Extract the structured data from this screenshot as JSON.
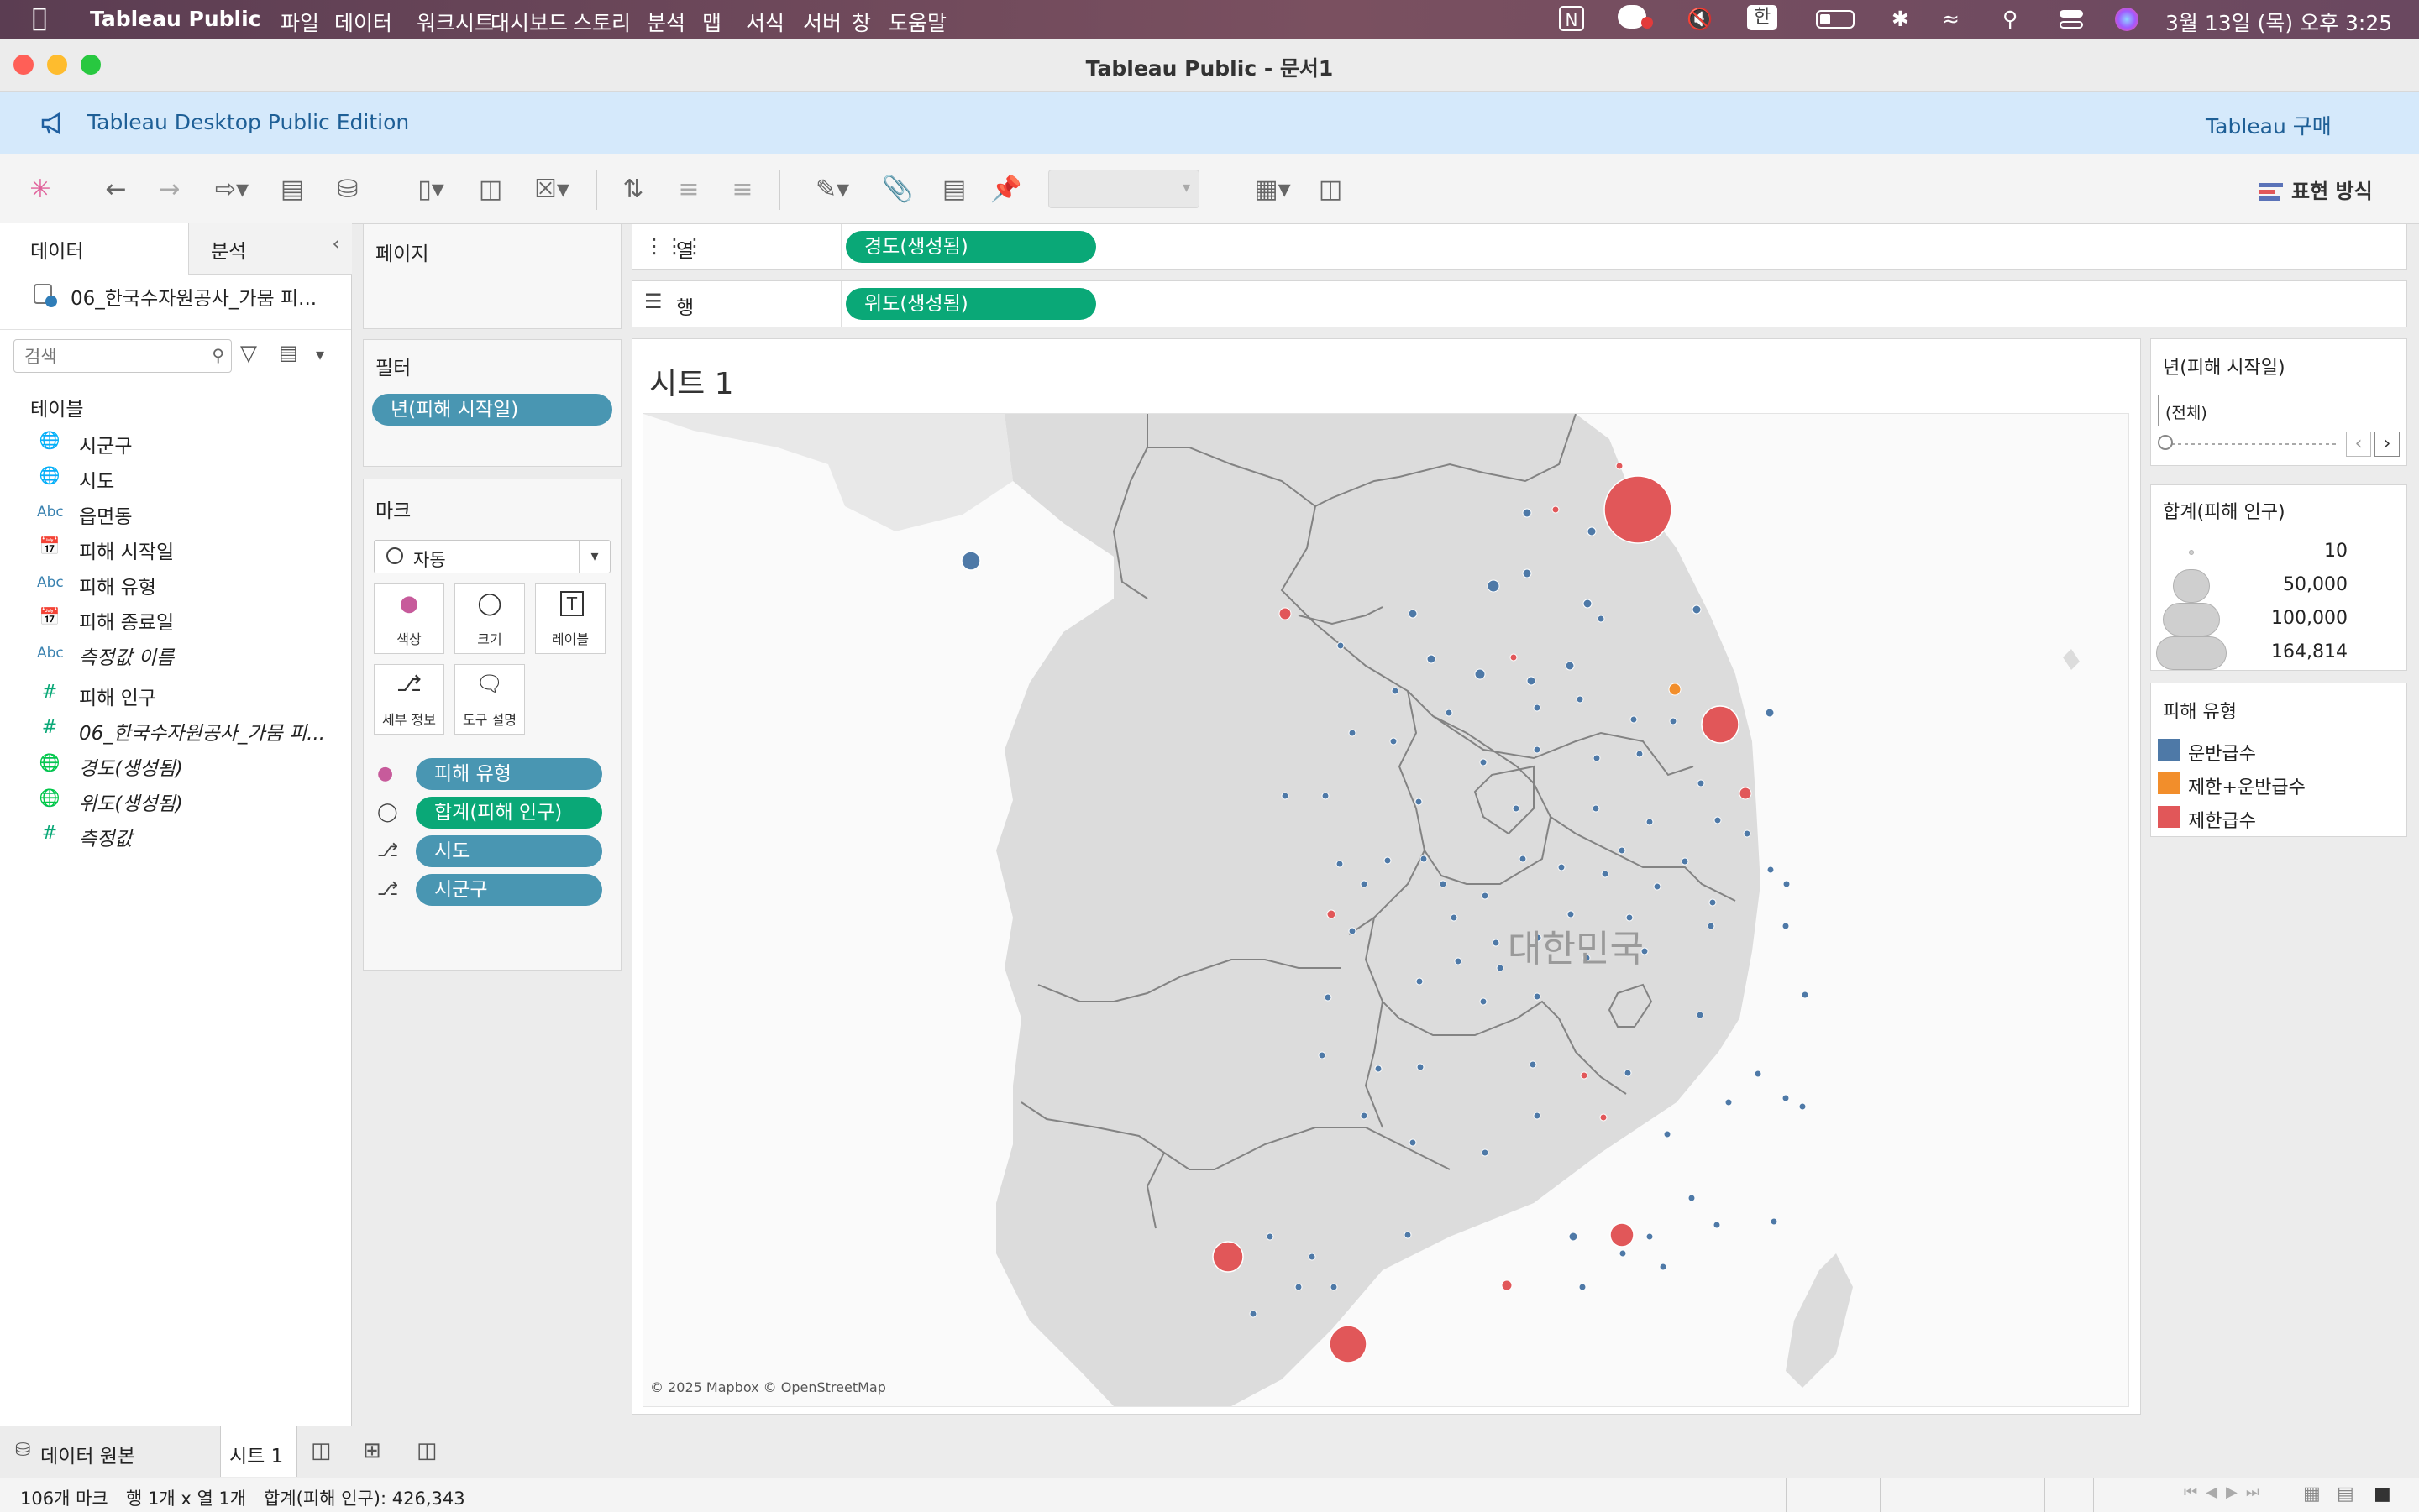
{
  "menubar": {
    "app_name": "Tableau Public",
    "items": [
      "파일",
      "데이터",
      "워크시트",
      "대시보드",
      "스토리",
      "분석",
      "맵",
      "서식",
      "서버",
      "창",
      "도움말"
    ],
    "ime": "한",
    "clock": "3월 13일 (목) 오후 3:25"
  },
  "window": {
    "title": "Tableau Public - 문서1"
  },
  "banner": {
    "text": "Tableau Desktop Public Edition",
    "buy_link": "Tableau 구매"
  },
  "toolbar": {
    "show_me": "표현 방식"
  },
  "data_pane": {
    "tab_data": "데이터",
    "tab_analysis": "분석",
    "datasource": "06_한국수자원공사_가뭄 피...",
    "search_placeholder": "검색",
    "tables_header": "테이블",
    "fields": [
      {
        "icon": "globe-icon",
        "label": "시군구"
      },
      {
        "icon": "globe-icon",
        "label": "시도"
      },
      {
        "icon": "abc-icon",
        "label": "읍면동"
      },
      {
        "icon": "calendar-icon",
        "label": "피해 시작일"
      },
      {
        "icon": "abc-icon",
        "label": "피해 유형"
      },
      {
        "icon": "calendar-icon",
        "label": "피해 종료일"
      },
      {
        "icon": "abc-icon",
        "label": "측정값 이름"
      },
      {
        "icon": "number-icon",
        "label": "피해 인구"
      },
      {
        "icon": "number-icon",
        "label": "06_한국수자원공사_가뭄 피..."
      },
      {
        "icon": "globe-icon",
        "label": "경도(생성됨)"
      },
      {
        "icon": "globe-icon",
        "label": "위도(생성됨)"
      },
      {
        "icon": "number-icon",
        "label": "측정값"
      }
    ]
  },
  "shelves": {
    "pages_label": "페이지",
    "filters_label": "필터",
    "filter_pill": "년(피해 시작일)",
    "columns_label": "열",
    "columns_pill": "경도(생성됨)",
    "rows_label": "행",
    "rows_pill": "위도(생성됨)"
  },
  "marks": {
    "label": "마크",
    "type": "자동",
    "buttons": [
      "색상",
      "크기",
      "레이블",
      "세부 정보",
      "도구 설명"
    ],
    "pills": [
      "피해 유형",
      "합계(피해 인구)",
      "시도",
      "시군구"
    ]
  },
  "sheet": {
    "title": "시트 1",
    "map_label": "대한민국",
    "attribution": "© 2025 Mapbox © OpenStreetMap"
  },
  "legends": {
    "filter_title": "년(피해 시작일)",
    "filter_value": "(전체)",
    "size_title": "합계(피해 인구)",
    "size_values": [
      "10",
      "50,000",
      "100,000",
      "164,814"
    ],
    "color_title": "피해 유형",
    "color_items": [
      {
        "label": "운반급수",
        "color": "#4e79a7"
      },
      {
        "label": "제한+운반급수",
        "color": "#f28e2b"
      },
      {
        "label": "제한급수",
        "color": "#e15759"
      }
    ]
  },
  "bottom_tabs": {
    "datasource": "데이터 원본",
    "sheet": "시트 1"
  },
  "status": {
    "marks": "106개 마크",
    "rows_cols": "행 1개 x 열 1개",
    "sum": "합계(피해 인구): 426,343"
  },
  "colors": {
    "blue": "#4e79a7",
    "orange": "#f28e2b",
    "red": "#e15759",
    "pill_blue": "#4996b2",
    "pill_green": "#0aa877"
  }
}
